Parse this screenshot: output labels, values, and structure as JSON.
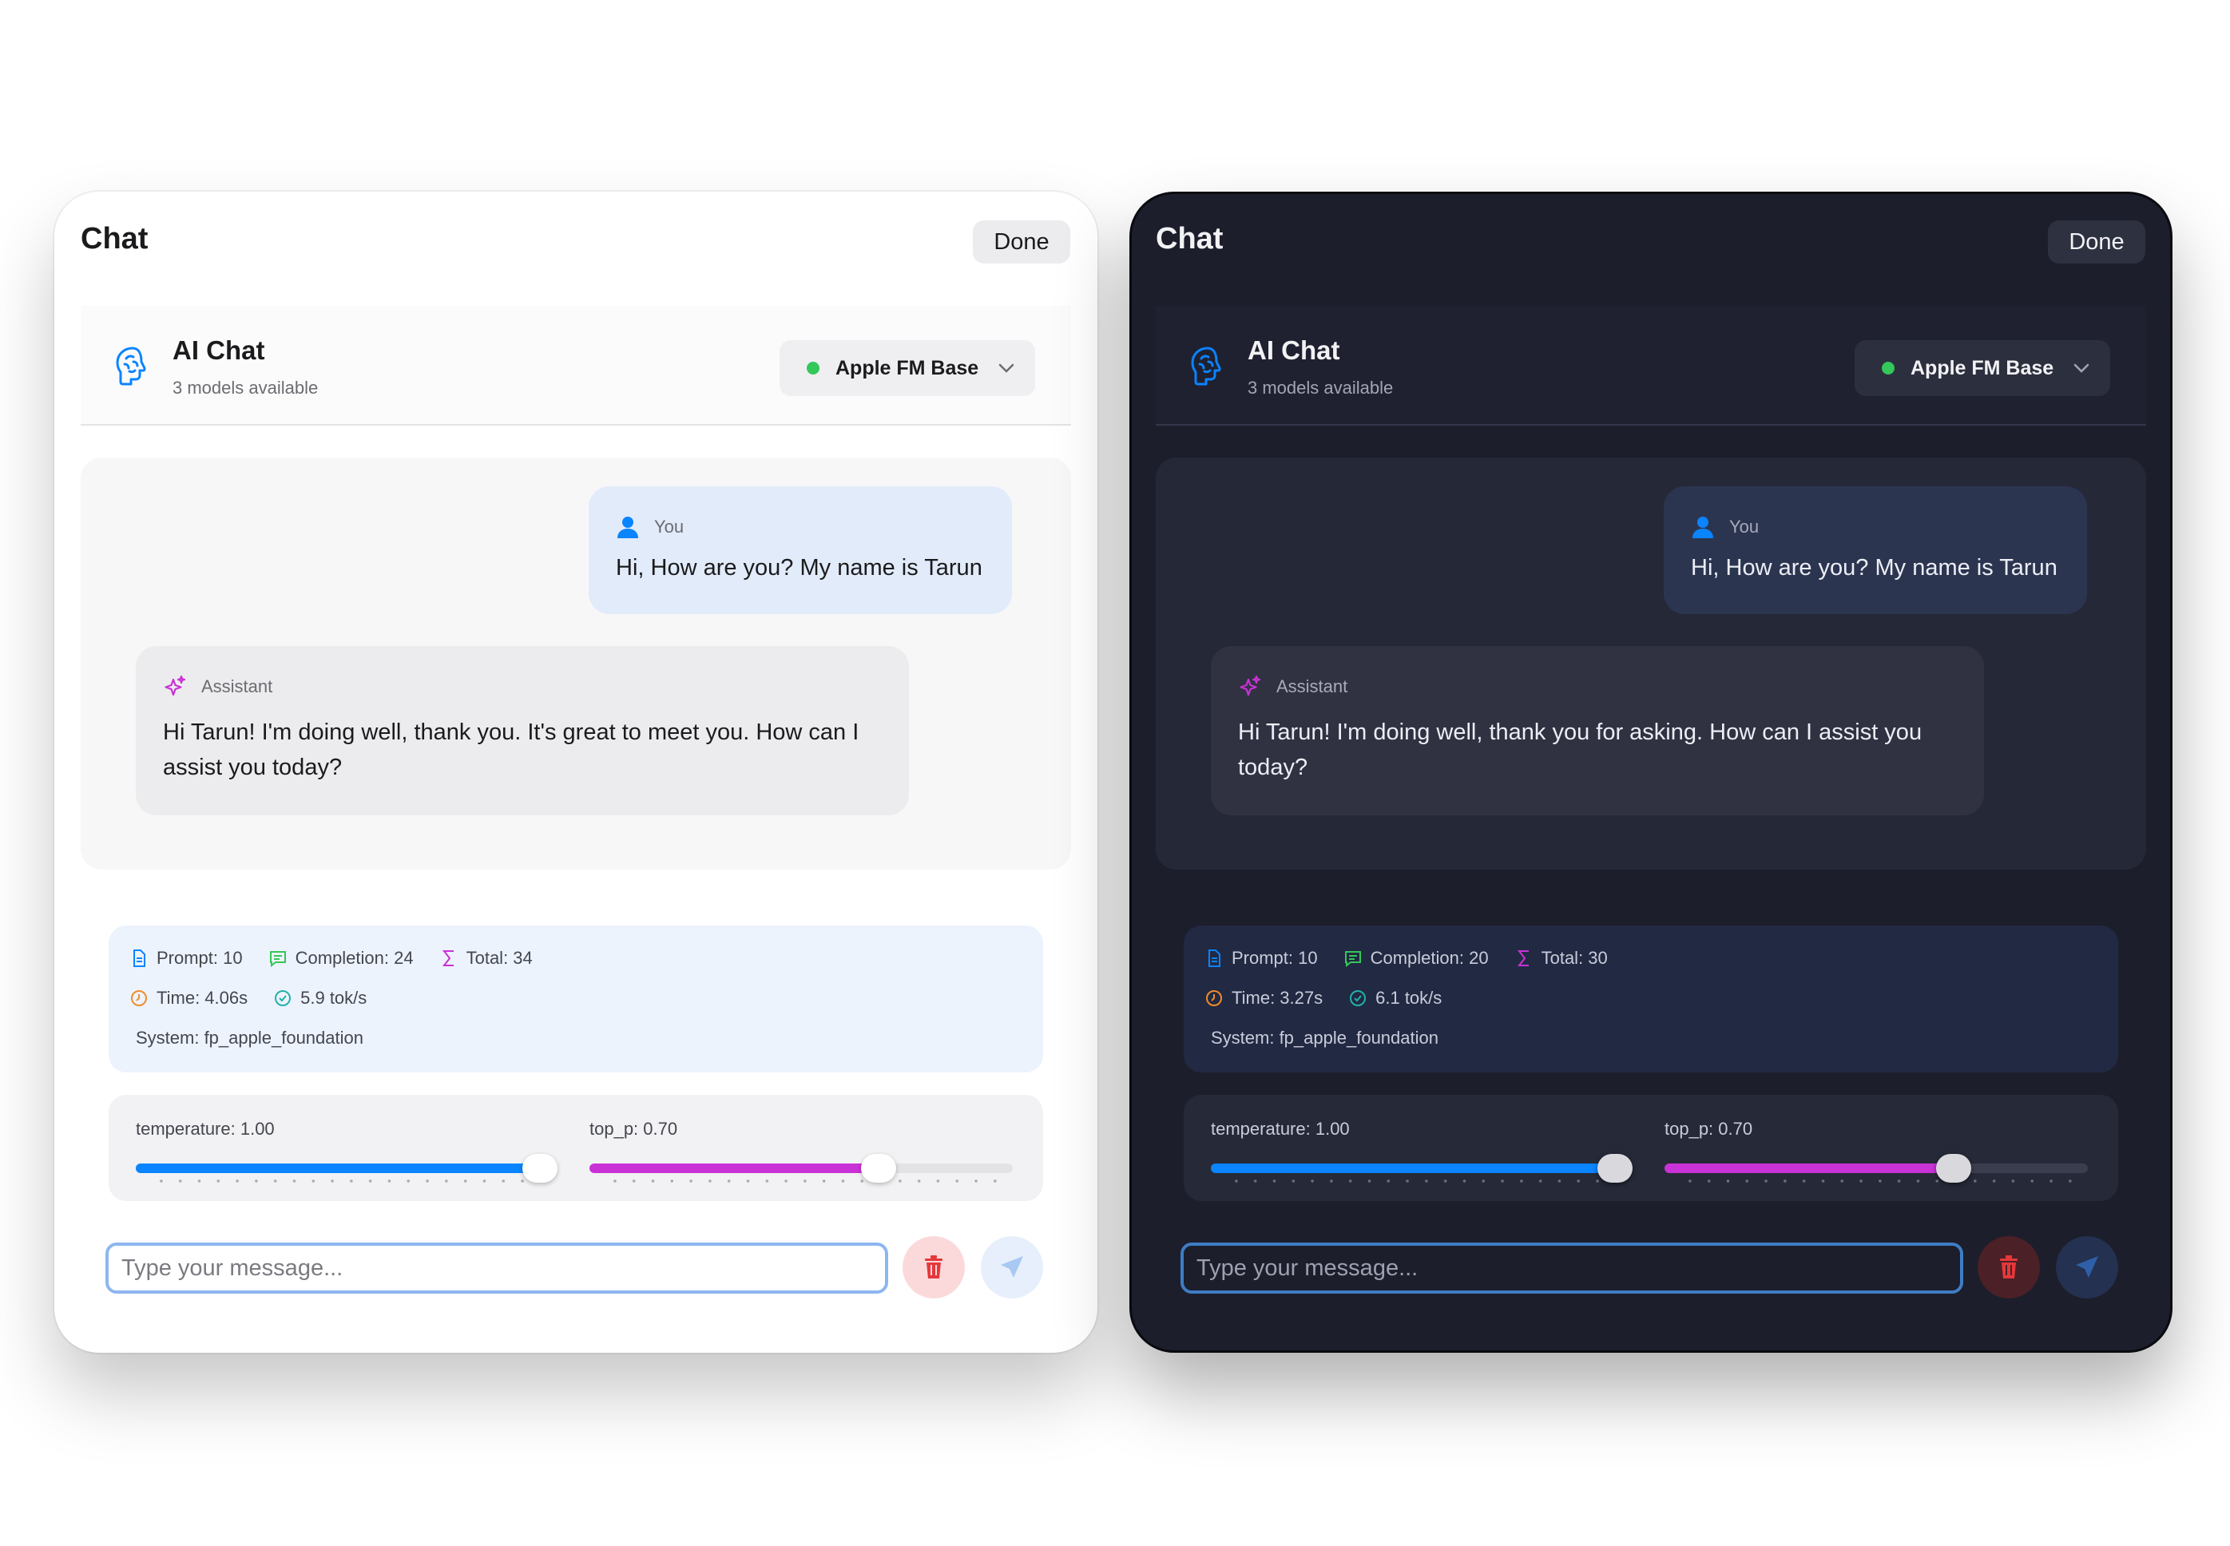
{
  "panels": [
    {
      "theme": "light",
      "title": "Chat",
      "done_label": "Done",
      "header": {
        "title": "AI Chat",
        "subtitle": "3 models available",
        "model": "Apple FM Base"
      },
      "messages": [
        {
          "role": "You",
          "text": "Hi, How are you? My name is Tarun"
        },
        {
          "role": "Assistant",
          "text": "Hi Tarun! I'm doing well, thank you. It's great to meet you. How can I assist you today?"
        }
      ],
      "stats": {
        "prompt": "Prompt: 10",
        "completion": "Completion: 24",
        "total": "Total: 34",
        "time": "Time: 4.06s",
        "speed": "5.9 tok/s",
        "system": "System: fp_apple_foundation"
      },
      "sliders": {
        "temperature_label": "temperature: 1.00",
        "temperature_fraction": 1.0,
        "top_p_label": "top_p: 0.70",
        "top_p_fraction": 0.7
      },
      "input_placeholder": "Type your message..."
    },
    {
      "theme": "dark",
      "title": "Chat",
      "done_label": "Done",
      "header": {
        "title": "AI Chat",
        "subtitle": "3 models available",
        "model": "Apple FM Base"
      },
      "messages": [
        {
          "role": "You",
          "text": "Hi, How are you? My name is Tarun"
        },
        {
          "role": "Assistant",
          "text": "Hi Tarun! I'm doing well, thank you for asking. How can I assist you today?"
        }
      ],
      "stats": {
        "prompt": "Prompt: 10",
        "completion": "Completion: 20",
        "total": "Total: 30",
        "time": "Time: 3.27s",
        "speed": "6.1 tok/s",
        "system": "System: fp_apple_foundation"
      },
      "sliders": {
        "temperature_label": "temperature: 1.00",
        "temperature_fraction": 1.0,
        "top_p_label": "top_p: 0.70",
        "top_p_fraction": 0.7
      },
      "input_placeholder": "Type your message..."
    }
  ],
  "colors": {
    "accent_blue": "#0a84ff",
    "accent_magenta": "#c932d6",
    "status_green": "#34c759",
    "danger_red": "#e5383b"
  },
  "icons": {
    "brain": "brain-head-icon",
    "user": "person-icon",
    "assistant": "sparkles-icon",
    "prompt": "document-icon",
    "completion": "chat-bubble-icon",
    "total": "sigma-icon",
    "time": "clock-icon",
    "speed": "gauge-icon",
    "delete": "trash-icon",
    "send": "paper-plane-icon"
  }
}
